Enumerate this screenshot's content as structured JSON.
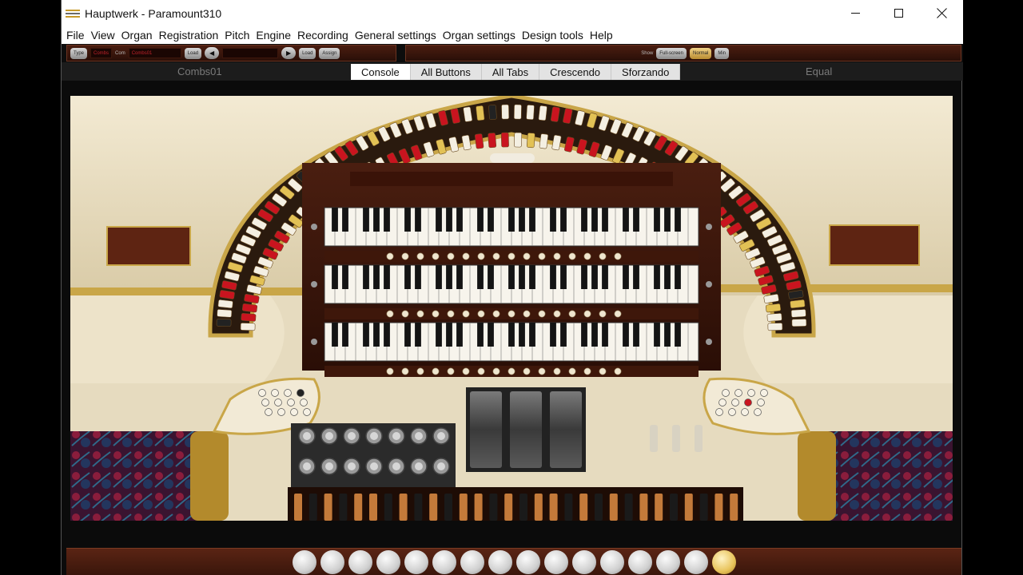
{
  "window": {
    "title": "Hauptwerk - Paramount310",
    "controls": {
      "minimize_icon": "minimize-icon",
      "maximize_icon": "maximize-icon",
      "close_icon": "close-icon"
    }
  },
  "menu": [
    "File",
    "View",
    "Organ",
    "Registration",
    "Pitch",
    "Engine",
    "Recording",
    "General settings",
    "Organ settings",
    "Design tools",
    "Help"
  ],
  "toolbar": {
    "type_label": "Type",
    "combs_display": "Combs",
    "com_label": "Com",
    "comb_display": "Combs01",
    "load_label": "Load",
    "load2_label": "Load",
    "assign_label": "Assign",
    "show_label": "Show",
    "full_screen_label": "Full-screen",
    "normal_label": "Normal",
    "min_label": "Min"
  },
  "tabbar": {
    "left_label": "Combs01",
    "right_label": "Equal",
    "tabs": [
      {
        "label": "Console",
        "active": true
      },
      {
        "label": "All Buttons",
        "active": false
      },
      {
        "label": "All Tabs",
        "active": false
      },
      {
        "label": "Crescendo",
        "active": false
      },
      {
        "label": "Sforzando",
        "active": false
      }
    ]
  },
  "console_image": "organ-console-image",
  "bottom_pistons": {
    "count": 16,
    "gold_index": 15
  },
  "colors": {
    "stop_red": "#c9141f",
    "stop_white": "#f4efe2",
    "stop_gold": "#e2c155",
    "wood": "#3a160b",
    "cream": "#efe4c8",
    "gilt": "#c9a648"
  }
}
